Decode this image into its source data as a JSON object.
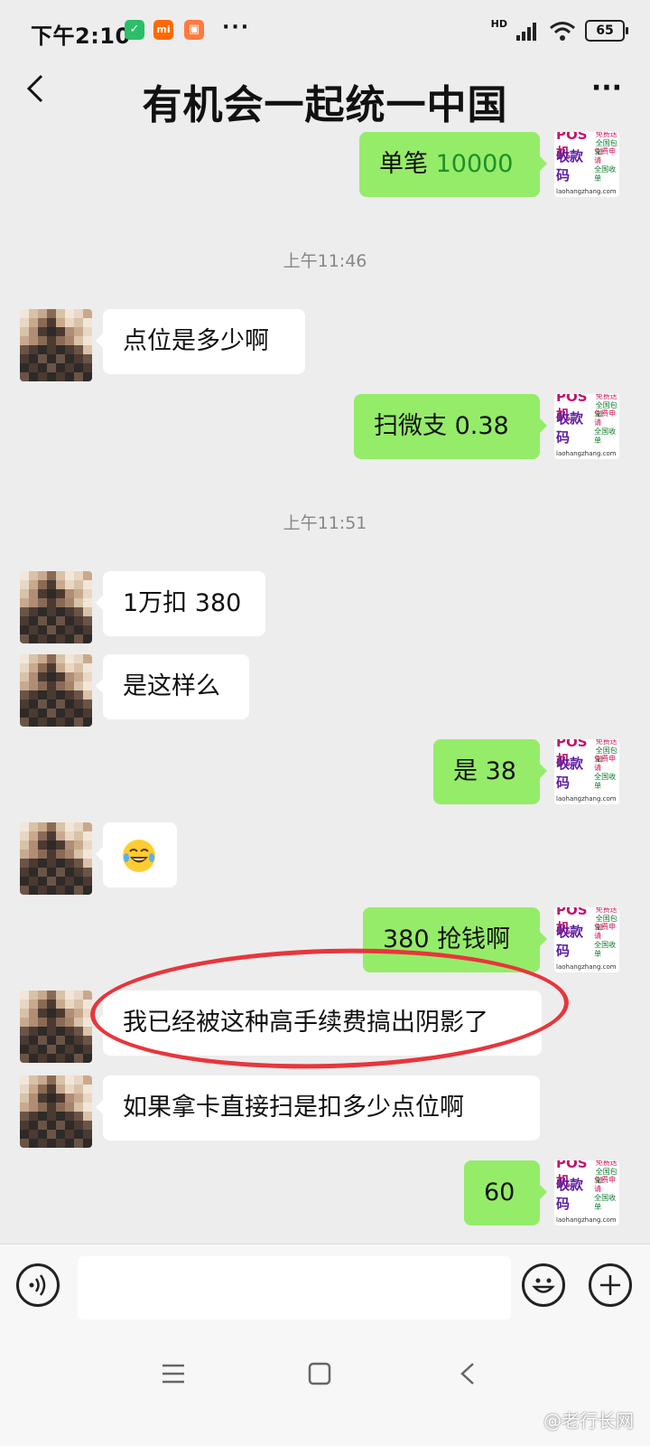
{
  "status_bar": {
    "time": "下午2:10",
    "app_icons": [
      "shield-icon",
      "mi-icon",
      "shop-icon"
    ],
    "more": "···",
    "network": "HD",
    "battery": "65"
  },
  "header": {
    "title": "有机会一起统一中国"
  },
  "ad_avatar": {
    "line1": "POS机",
    "line1_side": [
      "免费送",
      "全国包邮"
    ],
    "line2": "收款码",
    "line2_side": [
      "免费申请",
      "全国收单"
    ],
    "url": "laohangzhang.com"
  },
  "messages": [
    {
      "type": "out",
      "text": "单笔 ",
      "number": "10000"
    },
    {
      "type": "time",
      "text": "上午11:46"
    },
    {
      "type": "in",
      "text": "点位是多少啊"
    },
    {
      "type": "out",
      "text": "扫微支 0.38"
    },
    {
      "type": "time",
      "text": "上午11:51"
    },
    {
      "type": "in",
      "text": "1万扣 380"
    },
    {
      "type": "in",
      "text": "是这样么"
    },
    {
      "type": "out",
      "text": "是 38"
    },
    {
      "type": "in",
      "emoji": "laughing-tears"
    },
    {
      "type": "out",
      "text": "380 抢钱啊"
    },
    {
      "type": "in",
      "text": "我已经被这种高手续费搞出阴影了"
    },
    {
      "type": "in",
      "text": "如果拿卡直接扫是扣多少点位啊"
    },
    {
      "type": "out",
      "text": "60"
    }
  ],
  "input": {
    "placeholder": ""
  },
  "watermark": "@老行长网",
  "colors": {
    "background": "#ededed",
    "bubble_out": "#95ec69",
    "bubble_in": "#ffffff",
    "annotation": "#e8353c"
  }
}
